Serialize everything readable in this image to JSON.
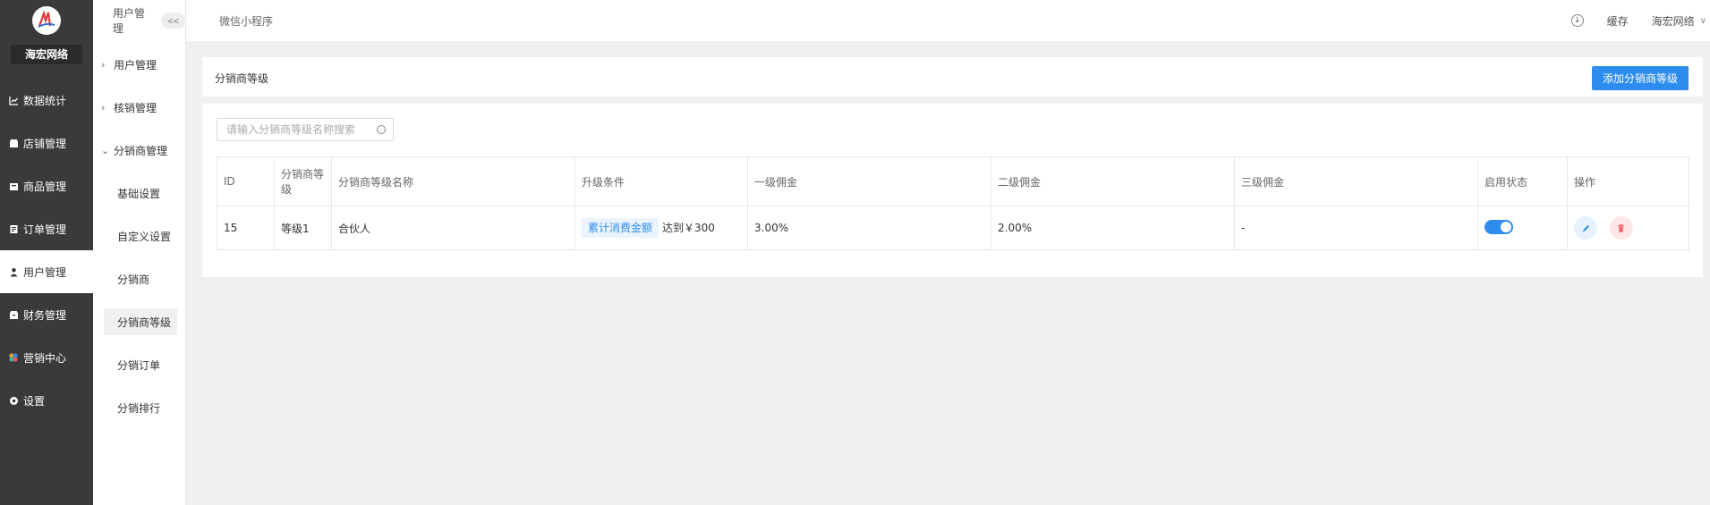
{
  "brand": {
    "name": "海宏网络"
  },
  "main_nav": [
    {
      "label": "数据统计",
      "icon": "chart-icon",
      "active": false
    },
    {
      "label": "店铺管理",
      "icon": "store-icon",
      "active": false
    },
    {
      "label": "商品管理",
      "icon": "goods-icon",
      "active": false
    },
    {
      "label": "订单管理",
      "icon": "order-icon",
      "active": false
    },
    {
      "label": "用户管理",
      "icon": "user-icon",
      "active": true
    },
    {
      "label": "财务管理",
      "icon": "finance-icon",
      "active": false
    },
    {
      "label": "营销中心",
      "icon": "marketing-icon",
      "active": false
    },
    {
      "label": "设置",
      "icon": "settings-icon",
      "active": false
    }
  ],
  "sub_sidebar": {
    "title": "用户管理",
    "collapse_label": "<<",
    "items": [
      {
        "label": "用户管理",
        "type": "group"
      },
      {
        "label": "核销管理",
        "type": "group"
      },
      {
        "label": "分销商管理",
        "type": "group-open"
      },
      {
        "label": "基础设置",
        "type": "child"
      },
      {
        "label": "自定义设置",
        "type": "child"
      },
      {
        "label": "分销商",
        "type": "child"
      },
      {
        "label": "分销商等级",
        "type": "child-selected"
      },
      {
        "label": "分销订单",
        "type": "child"
      },
      {
        "label": "分销排行",
        "type": "child"
      }
    ]
  },
  "topbar": {
    "title": "微信小程序",
    "cache_label": "缓存",
    "user_label": "海宏网络"
  },
  "panel": {
    "title": "分销商等级",
    "add_button": "添加分销商等级",
    "search_placeholder": "请输入分销商等级名称搜索"
  },
  "table": {
    "headers": [
      "ID",
      "分销商等级",
      "分销商等级名称",
      "升级条件",
      "一级佣金",
      "二级佣金",
      "三级佣金",
      "启用状态",
      "操作"
    ],
    "rows": [
      {
        "id": "15",
        "level": "等级1",
        "name": "合伙人",
        "condition_tag": "累计消费金额",
        "condition_text": "达到￥300",
        "commission1": "3.00%",
        "commission2": "2.00%",
        "commission3": "-",
        "enabled": true
      }
    ]
  },
  "colors": {
    "primary": "#2d8cf0",
    "sidebar": "#3a3a3a",
    "danger": "#f5686b"
  }
}
